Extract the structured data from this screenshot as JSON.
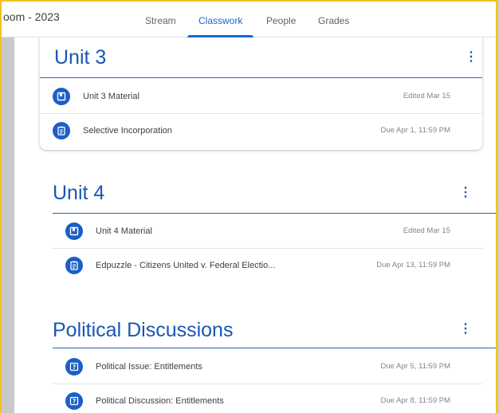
{
  "header": {
    "class_name": "oom - 2023",
    "tabs": [
      {
        "label": "Stream"
      },
      {
        "label": "Classwork"
      },
      {
        "label": "People"
      },
      {
        "label": "Grades"
      }
    ],
    "active_tab": "Classwork"
  },
  "topics": [
    {
      "title": "Unit 3",
      "items": [
        {
          "title": "Unit 3 Material",
          "meta": "Edited Mar 15",
          "icon": "material-icon"
        },
        {
          "title": "Selective Incorporation",
          "meta": "Due Apr 1, 11:59 PM",
          "icon": "assignment-icon"
        }
      ]
    },
    {
      "title": "Unit 4",
      "items": [
        {
          "title": "Unit 4 Material",
          "meta": "Edited Mar 15",
          "icon": "material-icon"
        },
        {
          "title": "Edpuzzle - Citizens United v. Federal Electio...",
          "meta": "Due Apr 13, 11:59 PM",
          "icon": "assignment-icon"
        }
      ]
    },
    {
      "title": "Political Discussions",
      "items": [
        {
          "title": "Political Issue: Entitlements",
          "meta": "Due Apr 5, 11:59 PM",
          "icon": "question-icon"
        },
        {
          "title": "Political Discussion: Entitlements",
          "meta": "Due Apr 8, 11:59 PM",
          "icon": "question-icon"
        }
      ]
    }
  ],
  "colors": {
    "accent": "#1967d2",
    "icon_bg": "#1a5fc9",
    "frame": "#f2c21b"
  }
}
